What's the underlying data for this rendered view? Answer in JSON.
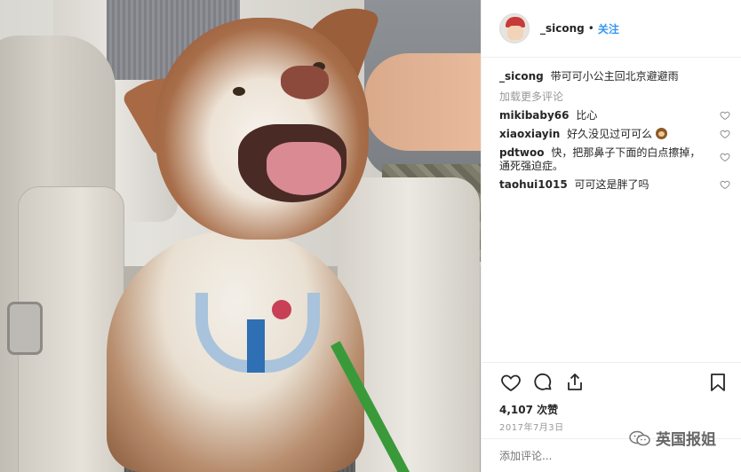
{
  "header": {
    "username": "_sicong",
    "separator": "•",
    "follow_label": "关注"
  },
  "caption": {
    "username": "_sicong",
    "text": "带可可小公主回北京避避雨"
  },
  "load_more_label": "加载更多评论",
  "comments": [
    {
      "username": "mikibaby66",
      "text": "比心"
    },
    {
      "username": "xiaoxiayin",
      "text": "好久没见过可可么",
      "emoji": "monkey-emoji"
    },
    {
      "username": "pdtwoo",
      "text": "快，把那鼻子下面的白点擦掉，通死强迫症。"
    },
    {
      "username": "taohui1015",
      "text": "可可这是胖了吗"
    }
  ],
  "likes": "4,107 次赞",
  "date": "2017年7月3日",
  "add_comment_placeholder": "添加评论...",
  "watermark": "英国报姐",
  "colors": {
    "link_blue": "#3897f0",
    "muted_gray": "#999999",
    "leash_green": "#3a9a3a"
  }
}
